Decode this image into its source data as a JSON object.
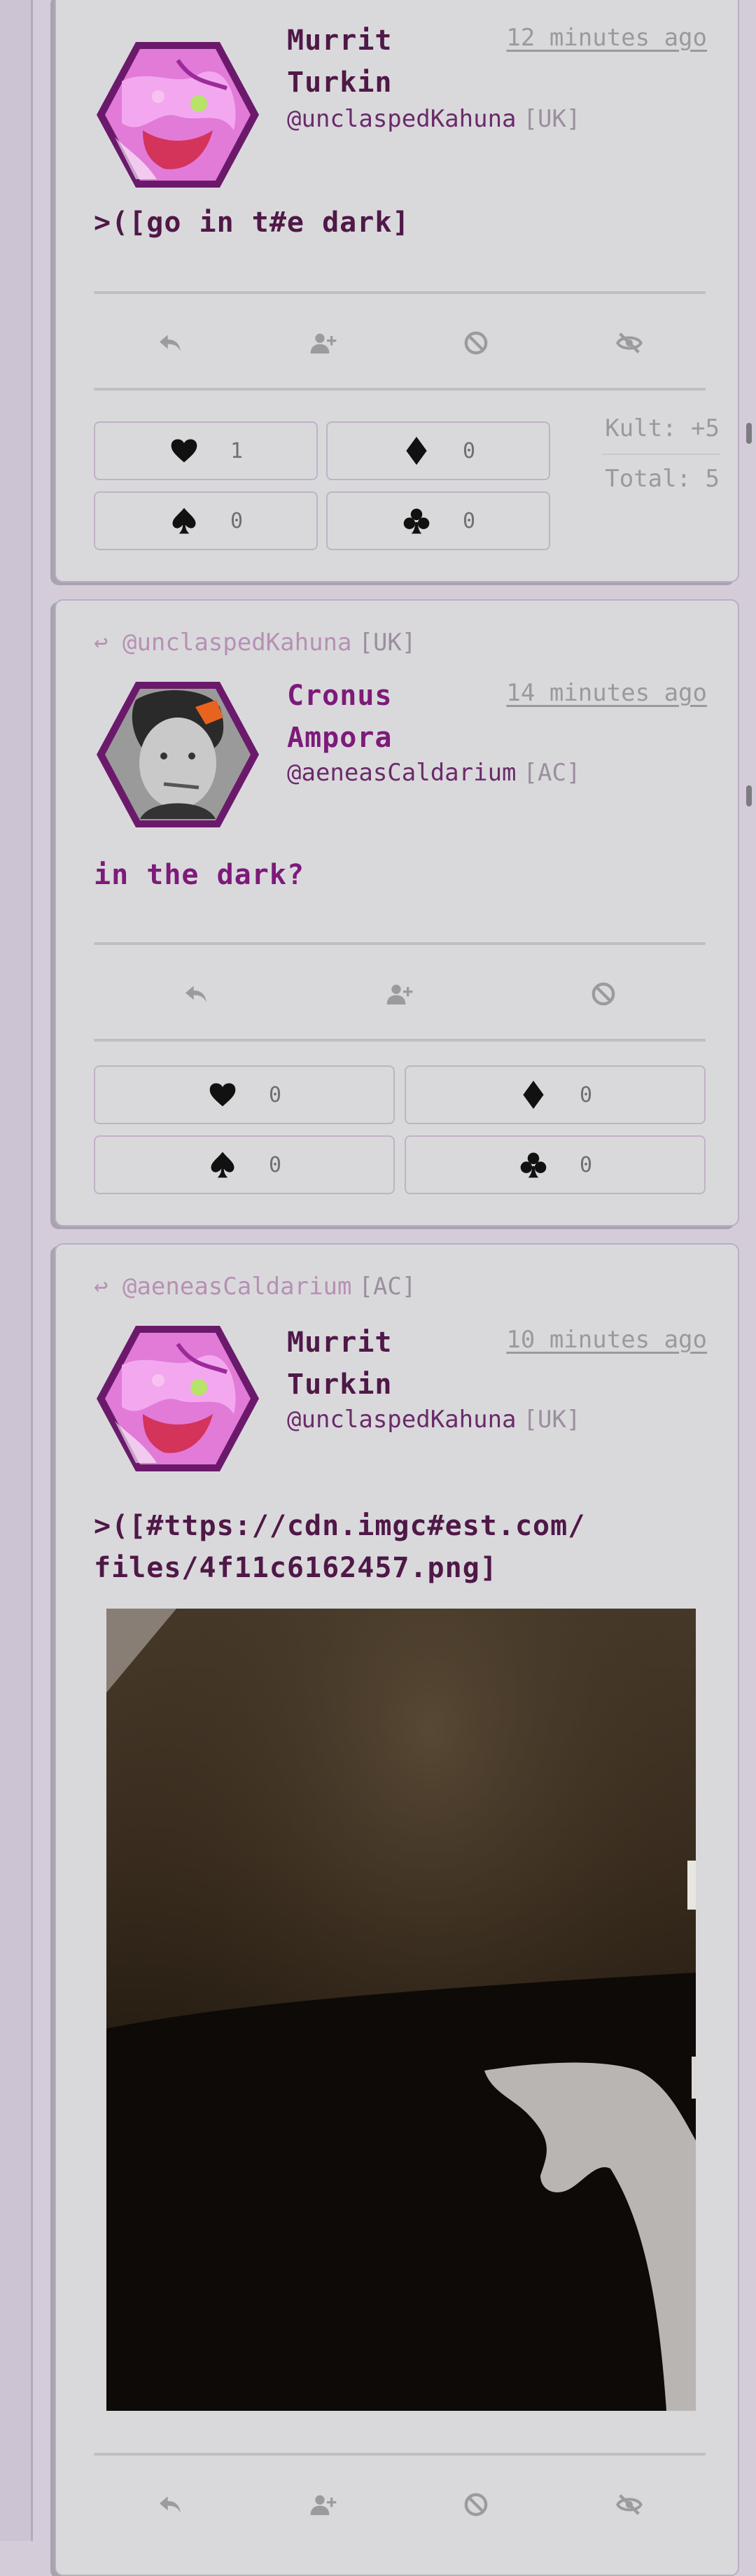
{
  "posts": [
    {
      "author": {
        "name": "Murrit\nTurkin",
        "handle": "@unclaspedKahuna",
        "tag": "[UK]"
      },
      "time": "12 minutes ago",
      "body": ">([go in t#e dark]",
      "reactions": [
        {
          "icon": "heart-icon",
          "count": "1"
        },
        {
          "icon": "diamond-icon",
          "count": "0"
        },
        {
          "icon": "spade-icon",
          "count": "0"
        },
        {
          "icon": "club-icon",
          "count": "0"
        }
      ],
      "kult": "Kult: +5",
      "total": "Total: 5"
    },
    {
      "reply_to": {
        "handle": "@unclaspedKahuna",
        "tag": "[UK]"
      },
      "author": {
        "name": "Cronus\nAmpora",
        "handle": "@aeneasCaldarium",
        "tag": "[AC]"
      },
      "time": "14 minutes ago",
      "body": "in the dark?",
      "reactions": [
        {
          "icon": "heart-icon",
          "count": "0"
        },
        {
          "icon": "diamond-icon",
          "count": "0"
        },
        {
          "icon": "spade-icon",
          "count": "0"
        },
        {
          "icon": "club-icon",
          "count": "0"
        }
      ]
    },
    {
      "reply_to": {
        "handle": "@aeneasCaldarium",
        "tag": "[AC]"
      },
      "author": {
        "name": "Murrit\nTurkin",
        "handle": "@unclaspedKahuna",
        "tag": "[UK]"
      },
      "time": "10 minutes ago",
      "body": ">([#ttps://cdn.imgc#est.com/\nfiles/4f11c6162457.png]"
    }
  ],
  "colors": {
    "accent_dark": "#4f1847",
    "accent_purple": "#7d1a7a",
    "avatar_border": "#6b1a6b"
  }
}
